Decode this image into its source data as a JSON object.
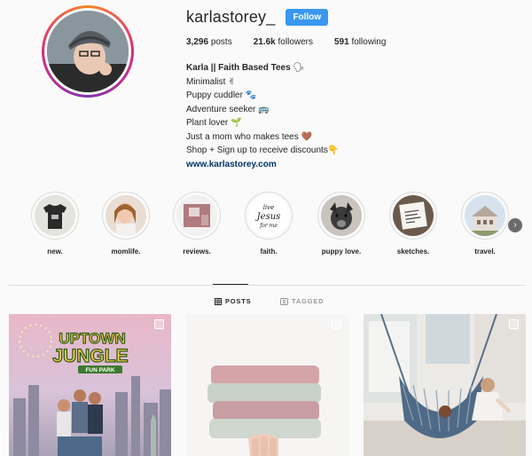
{
  "profile": {
    "username": "karlastorey_",
    "follow_label": "Follow",
    "stats": [
      {
        "value": "3,296",
        "label": "posts"
      },
      {
        "value": "21.6k",
        "label": "followers"
      },
      {
        "value": "591",
        "label": "following"
      }
    ],
    "bio": {
      "name": "Karla || Faith Based Tees",
      "name_emoji": "🗣",
      "lines": [
        {
          "text": "Minimalist",
          "emoji": "✌"
        },
        {
          "text": "Puppy cuddler",
          "emoji": "🐾"
        },
        {
          "text": "Adventure seeker",
          "emoji": "🚌"
        },
        {
          "text": "Plant lover",
          "emoji": "🌱"
        },
        {
          "text": "Just a mom who makes tees",
          "emoji": "🤎"
        },
        {
          "text": "Shop + Sign up to receive discounts",
          "emoji": "👇"
        }
      ],
      "link": "www.karlastorey.com"
    }
  },
  "highlights": [
    {
      "label": "new."
    },
    {
      "label": "momlife."
    },
    {
      "label": "reviews."
    },
    {
      "label": "faith."
    },
    {
      "label": "puppy love."
    },
    {
      "label": "sketches."
    },
    {
      "label": "travel."
    }
  ],
  "highlight_next_icon": "chevron-right-icon",
  "tabs": [
    {
      "label": "POSTS",
      "icon": "grid-icon",
      "active": true
    },
    {
      "label": "TAGGED",
      "icon": "tag-icon",
      "active": false
    }
  ],
  "posts": {
    "post1_text": {
      "line1": "UPTOWN",
      "line2": "JUNGLE",
      "line3": "FUN PARK"
    },
    "highlight_faith_text": {
      "line1": "live",
      "line2": "Jesus",
      "line3": "for me"
    }
  },
  "colors": {
    "accent": "#3897f0",
    "link": "#003569",
    "muted": "#999999"
  }
}
